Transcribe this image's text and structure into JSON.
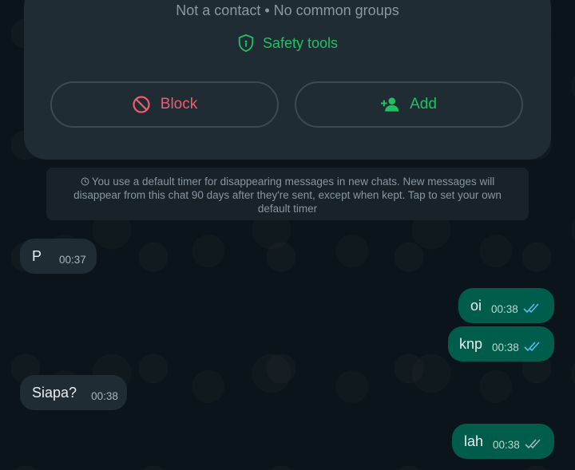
{
  "header": {
    "contact_info": "Not a contact • No common groups",
    "safety_tools_label": "Safety tools"
  },
  "actions": {
    "block_label": "Block",
    "add_label": "Add"
  },
  "notice": {
    "text": "You use a default timer for disappearing messages in new chats. New messages will disappear from this chat 90 days after they're sent, except when kept. Tap to set your own default timer"
  },
  "messages": [
    {
      "direction": "incoming",
      "text": "P",
      "time": "00:37"
    },
    {
      "direction": "outgoing",
      "text": "oi",
      "time": "00:38",
      "status": "read"
    },
    {
      "direction": "outgoing",
      "text": "knp",
      "time": "00:38",
      "status": "read"
    },
    {
      "direction": "incoming",
      "text": "Siapa?",
      "time": "00:38"
    },
    {
      "direction": "outgoing",
      "text": "lah",
      "time": "00:38",
      "status": "read"
    }
  ],
  "colors": {
    "background": "#0b141a",
    "incoming_bubble": "#1f2c34",
    "outgoing_bubble": "#005c4b",
    "accent_green": "#21c063",
    "danger_red": "#f15c6d",
    "read_ticks": "#53bdeb"
  }
}
